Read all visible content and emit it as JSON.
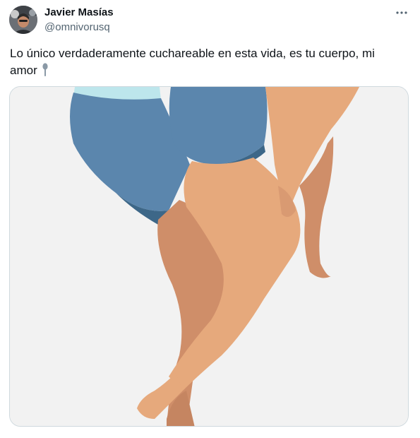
{
  "author": {
    "name": "Javier Masías",
    "handle": "@omnivorusq"
  },
  "tweet": {
    "text": "Lo único verdaderamente cuchareable en esta vida, es tu cuerpo, mi amor",
    "emoji_icon": "spoon-icon"
  },
  "header": {
    "more_icon": "more-options-icon"
  },
  "colors": {
    "background": "#ffffff",
    "text": "#0f1419",
    "secondary_text": "#536471",
    "border": "#cfd9de",
    "illustration_bg": "#f2f2f2",
    "shorts": "#5b86ad",
    "shirt": "#bde6ec",
    "skin_light": "#e6a97c",
    "skin_dark": "#cf8e69"
  }
}
